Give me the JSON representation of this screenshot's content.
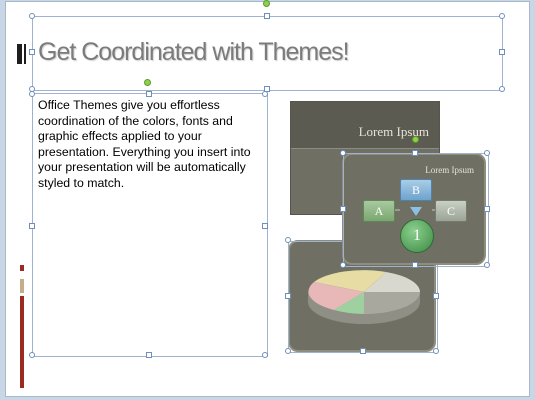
{
  "slide": {
    "title": "Get Coordinated with Themes!",
    "body": "Office Themes give you effortless coordination of the colors, fonts and graphic effects applied to your presentation. Everything you insert into your presentation will be automatically styled to match."
  },
  "graphics": {
    "card1_title": "Lorem Ipsum",
    "card2_title": "Lorem Ipsum",
    "node_a": "A",
    "node_b": "B",
    "node_c": "C",
    "node_1": "1"
  },
  "colors": {
    "accent_bar_dark": "#9b2a21",
    "accent_bar_tan": "#c5ad8a",
    "card_bg": "#6f6f64"
  }
}
